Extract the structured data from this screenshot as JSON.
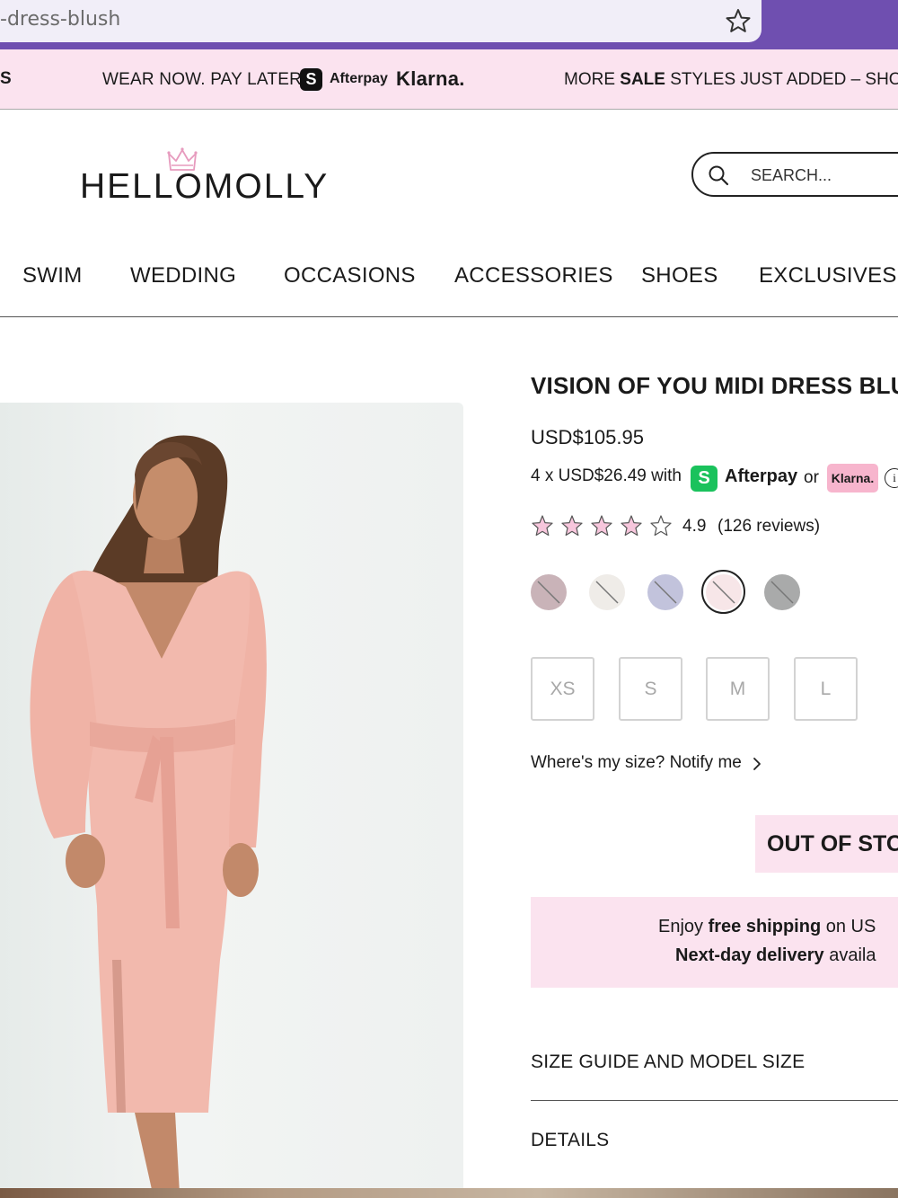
{
  "browser": {
    "url_fragment": "-dress-blush",
    "accent_color": "#6f4fb0"
  },
  "promo": {
    "left_fragment": "S",
    "wear_now": "WEAR NOW. PAY LATER",
    "afterpay_badge": "S",
    "afterpay_label": "Afterpay",
    "klarna_label": "Klarna.",
    "more_prefix": "MORE ",
    "more_bold": "SALE",
    "more_suffix": " STYLES JUST ADDED – SHOP",
    "bg_color": "#fbe3ef"
  },
  "header": {
    "logo_text": "HELLOMOLLY",
    "search_placeholder": "SEARCH..."
  },
  "nav": {
    "items": [
      "SWIM",
      "WEDDING",
      "OCCASIONS",
      "ACCESSORIES",
      "SHOES",
      "EXCLUSIVES"
    ]
  },
  "product": {
    "title": "VISION OF YOU MIDI DRESS BLU",
    "price": "USD$105.95",
    "installments_text": "4 x USD$26.49 with",
    "afterpay_badge": "S",
    "afterpay_label": "Afterpay",
    "or_label": "or",
    "klarna_label": "Klarna.",
    "info_icon": "i",
    "rating_value": "4.9",
    "reviews_count": "(126 reviews)",
    "stars_total": 5,
    "swatches": [
      {
        "color": "#c9b3b8",
        "selected": false
      },
      {
        "color": "#efece8",
        "selected": false
      },
      {
        "color": "#c2c3dc",
        "selected": false
      },
      {
        "color": "#f7e6e8",
        "selected": true
      },
      {
        "color": "#a9aaaa",
        "selected": false
      }
    ],
    "sizes": [
      "XS",
      "S",
      "M",
      "L"
    ],
    "notify_text": "Where's my size? Notify me",
    "stock_status": "OUT OF STO",
    "shipping_line1_prefix": "Enjoy ",
    "shipping_line1_bold": "free shipping",
    "shipping_line1_suffix": " on US",
    "shipping_line2_bold": "Next-day delivery",
    "shipping_line2_suffix": " availa",
    "accordion": [
      "SIZE GUIDE AND MODEL SIZE",
      "DETAILS"
    ]
  }
}
